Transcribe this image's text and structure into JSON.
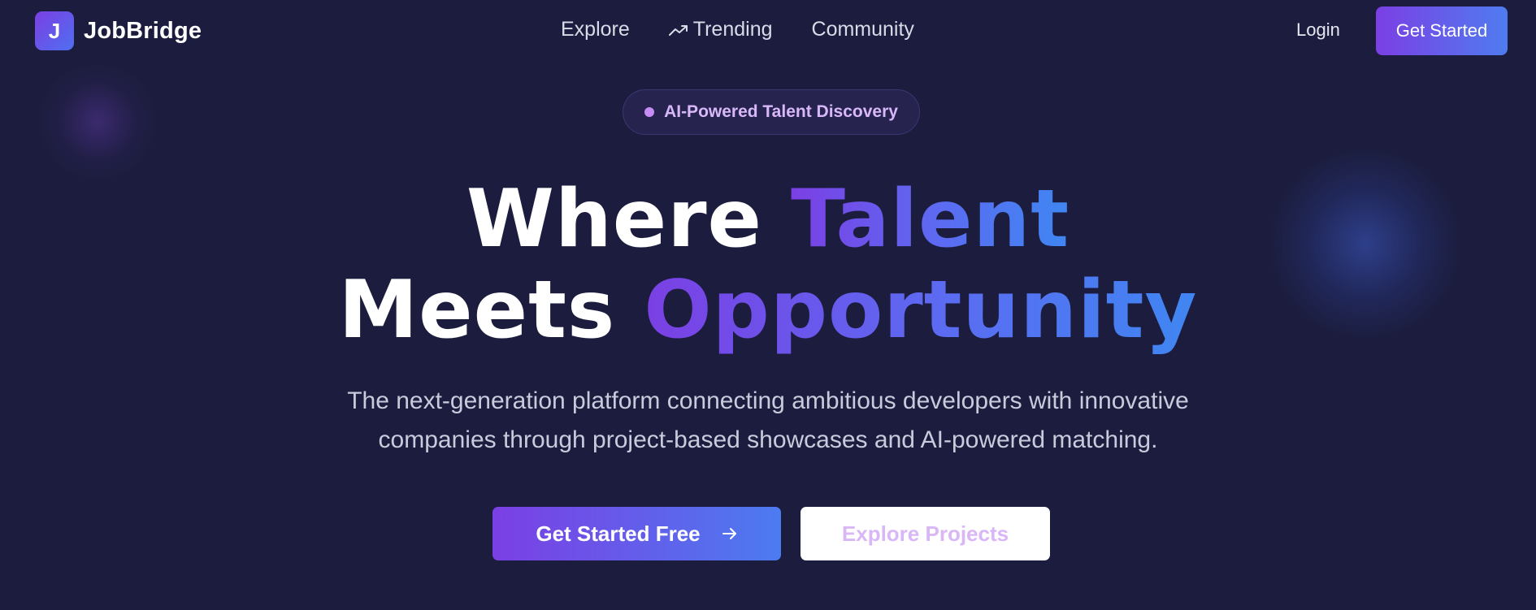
{
  "nav": {
    "logo_letter": "J",
    "brand": "JobBridge",
    "links": [
      {
        "label": "Explore",
        "icon": null
      },
      {
        "label": "Trending",
        "icon": "trending-up-icon"
      },
      {
        "label": "Community",
        "icon": null
      }
    ],
    "login_label": "Login",
    "cta_label": "Get Started"
  },
  "hero": {
    "badge": "AI-Powered Talent Discovery",
    "headline_line1_plain": "Where ",
    "headline_line1_accent": "Talent",
    "headline_line2_plain": "Meets ",
    "headline_line2_accent": "Opportunity",
    "subtitle_line1": "The next-generation platform connecting ambitious developers with innovative",
    "subtitle_line2": "companies through project-based showcases and AI-powered matching.",
    "primary_cta": "Get Started Free",
    "secondary_cta": "Explore Projects"
  },
  "colors": {
    "background": "#1c1d3e",
    "accent_start": "#7b3fe4",
    "accent_end": "#3f86f2",
    "badge_text": "#d8b8f8"
  }
}
